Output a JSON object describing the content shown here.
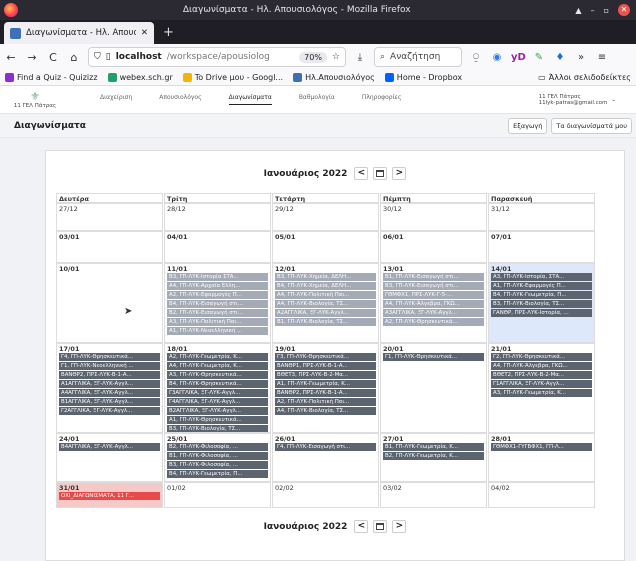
{
  "window": {
    "title": "Διαγωνίσματα - Ηλ. Απουσιολόγος - Mozilla Firefox"
  },
  "tab": {
    "title": "Διαγωνίσματα - Ηλ. Απουσ",
    "close": "✕",
    "new": "+"
  },
  "nav": {
    "back": "←",
    "forward": "→",
    "reload": "C",
    "home": "⌂",
    "host": "localhost",
    "path": "/workspace/apousiolog",
    "zoom": "70%",
    "star": "☆",
    "download": "⤓",
    "search_icon": "⌕",
    "search_text": "Αναζήτηση",
    "more": "»",
    "menu": "≡"
  },
  "bookmarks": [
    {
      "label": "Find a Quiz - Quizizz",
      "color": "#8e2bd1"
    },
    {
      "label": "webex.sch.gr",
      "color": "#22a06b"
    },
    {
      "label": "To Drive μου - Googl...",
      "color": "#f4b400"
    },
    {
      "label": "Ηλ.Απουσιολόγος",
      "color": "#3e70b5"
    },
    {
      "label": "Home - Dropbox",
      "color": "#0061fe"
    }
  ],
  "bookmarks_other": "Άλλοι σελιδοδείκτες",
  "app": {
    "school": "11 ΓΕΛ Πάτρας",
    "nav": [
      "Διαχείριση",
      "Απουσιολόγος",
      "Διαγωνίσματα",
      "Βαθμολογία",
      "Πληροφορίες"
    ],
    "user_name": "11 ΓΕΛ Πάτρας",
    "user_email": "11lyk-patras@gmail.com",
    "page_title": "Διαγωνίσματα",
    "export_label": "Εξαγωγή",
    "mine_label": "Τα διαγωνίσματά μου"
  },
  "calendar": {
    "month": "Ιανουάριος 2022",
    "prev": "<",
    "next": ">",
    "days": [
      "Δευτέρα",
      "Τρίτη",
      "Τετάρτη",
      "Πέμπτη",
      "Παρασκευή"
    ],
    "weeks": [
      [
        {
          "date": "27/12",
          "events": []
        },
        {
          "date": "28/12",
          "events": []
        },
        {
          "date": "29/12",
          "events": []
        },
        {
          "date": "30/12",
          "events": []
        },
        {
          "date": "31/12",
          "events": []
        }
      ],
      [
        {
          "date": "03/01",
          "bold": true,
          "events": []
        },
        {
          "date": "04/01",
          "bold": true,
          "events": []
        },
        {
          "date": "05/01",
          "bold": true,
          "events": []
        },
        {
          "date": "06/01",
          "bold": true,
          "events": []
        },
        {
          "date": "07/01",
          "bold": true,
          "events": []
        }
      ],
      [
        {
          "date": "10/01",
          "bold": true,
          "events": []
        },
        {
          "date": "11/01",
          "bold": true,
          "light": true,
          "events": [
            "Β3, ΓΠ-ΛΥΚ-Ιστορία ΣΤΑ...",
            "Α4, ΓΠ-ΛΥΚ-Αρχαία Ελλη...",
            "Α2, ΓΠ-ΛΥΚ-Εφαρμογές Π...",
            "Β4, ΓΠ-ΛΥΚ-Εισαγωγή στι...",
            "Β2, ΓΠ-ΛΥΚ-Εισαγωγή στι...",
            "Α3, ΓΠ-ΛΥΚ-Πολιτική Παι...",
            "Α1, ΓΠ-ΛΥΚ-Νεοελληνική ..."
          ]
        },
        {
          "date": "12/01",
          "bold": true,
          "light": true,
          "events": [
            "Β3, ΓΠ-ΛΥΚ-Χημεία, ΔΕΛΗ...",
            "Β4, ΓΠ-ΛΥΚ-Χημεία, ΔΕΛΗ...",
            "Α4, ΓΠ-ΛΥΚ-Πολιτική Παι...",
            "Α4, ΓΠ-ΛΥΚ-Βιολογία, ΤΣ...",
            "Α2ΑΓΓΛΙΚΑ, ΞΓ-ΛΥΚ-Αγγλ...",
            "Β1, ΓΠ-ΛΥΚ-Βιολογία, ΤΣ..."
          ]
        },
        {
          "date": "13/01",
          "bold": true,
          "light": true,
          "events": [
            "Β1, ΓΠ-ΛΥΚ-Εισαγωγή στι...",
            "Β3, ΓΠ-ΛΥΚ-Εισαγωγή στι...",
            "ΓΘΜΦΧ1, ΠΡΣ-ΛΥΚ-Γ-5-...",
            "Α4, ΓΠ-ΛΥΚ-Άλγεβρα, ΓΚΩ...",
            "Α3ΑΓΓΛΙΚΑ, ΞΓ-ΛΥΚ-Αγγλ...",
            "Α2, ΓΠ-ΛΥΚ-Θρησκευτικά..."
          ]
        },
        {
          "date": "14/01",
          "bold": true,
          "blue": true,
          "events": [
            "Α3, ΓΠ-ΛΥΚ-Ιστορία, ΣΤΑ...",
            "Α1, ΓΠ-ΛΥΚ-Εφαρμογές Π...",
            "Β4, ΓΠ-ΛΥΚ-Γεωμετρία, Π...",
            "Β3, ΓΠ-ΛΥΚ-Βιολογία, ΤΣ...",
            "ΓΑΝΘΡ, ΠΡΣ-ΛΥΚ-Ιστορία, ..."
          ]
        }
      ],
      [
        {
          "date": "17/01",
          "bold": true,
          "events": [
            "Γ4, ΓΠ-ΛΥΚ-Θρησκευτικά...",
            "Γ1, ΓΠ-ΛΥΚ-Νεοελληνική ...",
            "ΒΑΝΘΡ2, ΠΡΣ-ΛΥΚ-Β-1-Α...",
            "Α1ΑΓΓΛΙΚΑ, ΞΓ-ΛΥΚ-Αγγλ...",
            "Α4ΑΓΓΛΙΚΑ, ΞΓ-ΛΥΚ-Αγγλ...",
            "Β1ΑΓΓΛΙΚΑ, ΞΓ-ΛΥΚ-Αγγλ...",
            "Γ2ΑΓΓΛΙΚΑ, ΞΓ-ΛΥΚ-Αγγλ..."
          ]
        },
        {
          "date": "18/01",
          "bold": true,
          "events": [
            "Α2, ΓΠ-ΛΥΚ-Γεωμετρία, Κ...",
            "Α4, ΓΠ-ΛΥΚ-Γεωμετρία, Κ...",
            "Α3, ΓΠ-ΛΥΚ-Θρησκευτικά...",
            "Β4, ΓΠ-ΛΥΚ-Θρησκευτικά...",
            "Γ3ΑΓΓΛΙΚΑ, ΞΓ-ΛΥΚ-Αγγλ...",
            "Γ4ΑΓΓΛΙΚΑ, ΞΓ-ΛΥΚ-Αγγλ...",
            "Β2ΑΓΓΛΙΚΑ, ΞΓ-ΛΥΚ-Αγγλ...",
            "Α1, ΓΠ-ΛΥΚ-Θρησκευτικά...",
            "Β3, ΓΠ-ΛΥΚ-Βιολογία, ΤΣ..."
          ]
        },
        {
          "date": "19/01",
          "bold": true,
          "events": [
            "Γ3, ΓΠ-ΛΥΚ-Θρησκευτικά...",
            "ΒΑΝΘΡ1, ΠΡΣ-ΛΥΚ-Β-1-Α...",
            "ΒΘΕΤ3, ΠΡΣ-ΛΥΚ-Β-2-Μα...",
            "Α1, ΓΠ-ΛΥΚ-Γεωμετρία, Κ...",
            "ΒΑΝΘΡ2, ΠΡΣ-ΛΥΚ-Β-1-Α...",
            "Α2, ΓΠ-ΛΥΚ-Πολιτική Παι...",
            "Α4, ΓΠ-ΛΥΚ-Βιολογία, ΤΣ..."
          ]
        },
        {
          "date": "20/01",
          "bold": true,
          "events": [
            "Γ1, ΓΠ-ΛΥΚ-Θρησκευτικά..."
          ]
        },
        {
          "date": "21/01",
          "bold": true,
          "events": [
            "Γ2, ΓΠ-ΛΥΚ-Θρησκευτικά...",
            "Α4, ΓΠ-ΛΥΚ-Άλγεβρα, ΓΚΩ...",
            "ΒΘΕΤ2, ΠΡΣ-ΛΥΚ-Β-2-Μα...",
            "Γ1ΑΓΓΛΙΚΑ, ΞΓ-ΛΥΚ-Αγγλ...",
            "Α3, ΓΠ-ΛΥΚ-Γεωμετρία, Κ..."
          ]
        }
      ],
      [
        {
          "date": "24/01",
          "bold": true,
          "events": [
            "Β4ΑΓΓΛΙΚΑ, ΞΓ-ΛΥΚ-Αγγλ..."
          ]
        },
        {
          "date": "25/01",
          "bold": true,
          "events": [
            "Β2, ΓΠ-ΛΥΚ-Φιλοσοφία, ...",
            "Β1, ΓΠ-ΛΥΚ-Φιλοσοφία, ...",
            "Β3, ΓΠ-ΛΥΚ-Φιλοσοφία, ...",
            "Β4, ΓΠ-ΛΥΚ-Γεωμετρία, Π..."
          ]
        },
        {
          "date": "26/01",
          "bold": true,
          "events": [
            "Γ4, ΓΠ-ΛΥΚ-Εισαγωγή στι..."
          ]
        },
        {
          "date": "27/01",
          "bold": true,
          "events": [
            "Β1, ΓΠ-ΛΥΚ-Γεωμετρία, Κ...",
            "Β2, ΓΠ-ΛΥΚ-Γεωμετρία, Κ..."
          ]
        },
        {
          "date": "28/01",
          "bold": true,
          "events": [
            "ΓΘΜΦΧ1-ΓΥΓΒΦΧ1, ΓΠ-Λ..."
          ]
        }
      ],
      [
        {
          "date": "31/01",
          "bold": true,
          "pink": true,
          "events": [
            "ΟΧΙ_ΔΙΑΓΩΝΙΣΜΑΤΑ, 11 Γ..."
          ]
        },
        {
          "date": "01/02",
          "events": []
        },
        {
          "date": "02/02",
          "events": []
        },
        {
          "date": "03/02",
          "events": []
        },
        {
          "date": "04/02",
          "events": []
        }
      ]
    ]
  }
}
